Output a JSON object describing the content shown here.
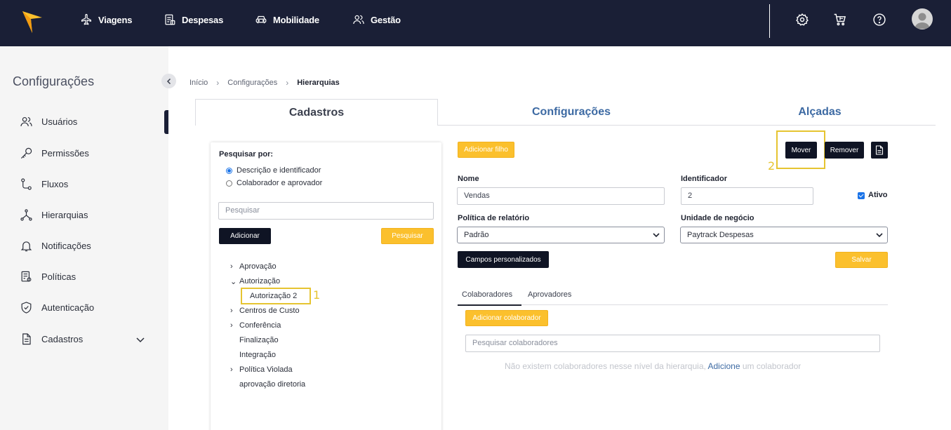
{
  "topnav": {
    "items": [
      {
        "label": "Viagens",
        "icon": "airplane-icon"
      },
      {
        "label": "Despesas",
        "icon": "receipt-icon"
      },
      {
        "label": "Mobilidade",
        "icon": "car-icon"
      },
      {
        "label": "Gestão",
        "icon": "users-icon"
      }
    ],
    "right_icons": [
      "gear-icon",
      "cart-icon",
      "help-icon",
      "avatar"
    ]
  },
  "sidebar": {
    "title": "Configurações",
    "items": [
      {
        "label": "Usuários",
        "icon": "users-icon"
      },
      {
        "label": "Permissões",
        "icon": "key-icon"
      },
      {
        "label": "Fluxos",
        "icon": "flow-icon"
      },
      {
        "label": "Hierarquias",
        "icon": "hierarchy-icon"
      },
      {
        "label": "Notificações",
        "icon": "bell-icon"
      },
      {
        "label": "Políticas",
        "icon": "policy-icon"
      },
      {
        "label": "Autenticação",
        "icon": "shield-icon"
      },
      {
        "label": "Cadastros",
        "icon": "document-icon"
      }
    ]
  },
  "breadcrumb": {
    "items": [
      "Início",
      "Configurações",
      "Hierarquias"
    ]
  },
  "tabs": [
    "Cadastros",
    "Configurações",
    "Alçadas"
  ],
  "search_panel": {
    "label": "Pesquisar por:",
    "options": [
      "Descrição e identificador",
      "Colaborador e aprovador"
    ],
    "selected_option": "Descrição e identificador",
    "search_placeholder": "Pesquisar",
    "add_button": "Adicionar",
    "search_button": "Pesquisar",
    "tree": [
      {
        "label": "Aprovação",
        "expand": "›"
      },
      {
        "label": "Autorização",
        "expand": "⌄"
      },
      {
        "label": "Autorização 2",
        "expand": ""
      },
      {
        "label": "Centros de Custo",
        "expand": "›"
      },
      {
        "label": "Conferência",
        "expand": "›"
      },
      {
        "label": "Finalização",
        "expand": ""
      },
      {
        "label": "Integração",
        "expand": ""
      },
      {
        "label": "Política Violada",
        "expand": "›"
      },
      {
        "label": "aprovação diretoria",
        "expand": ""
      }
    ],
    "annotation_1": "1"
  },
  "detail": {
    "add_child_button": "Adicionar filho",
    "move_button": "Mover",
    "remove_button": "Remover",
    "annotation_2": "2",
    "name_label": "Nome",
    "name_value": "Vendas",
    "identifier_label": "Identificador",
    "identifier_value": "2",
    "active_label": "Ativo",
    "active_checked": true,
    "policy_label": "Política de relatório",
    "policy_value": "Padrão",
    "business_unit_label": "Unidade de negócio",
    "business_unit_value": "Paytrack Despesas",
    "custom_fields_button": "Campos personalizados",
    "save_button": "Salvar",
    "subtabs": [
      "Colaboradores",
      "Aprovadores"
    ],
    "add_collaborator_button": "Adicionar colaborador",
    "collaborator_search_placeholder": "Pesquisar colaboradores",
    "empty_prefix": "Não existem colaboradores nesse nível da hierarquia, ",
    "empty_link": "Adicione",
    "empty_suffix": " um colaborador"
  },
  "colors": {
    "nav_bg": "#1a1f36",
    "accent_yellow": "#fbc02d",
    "link_blue": "#3d6aa3",
    "highlight": "#e6c431"
  }
}
